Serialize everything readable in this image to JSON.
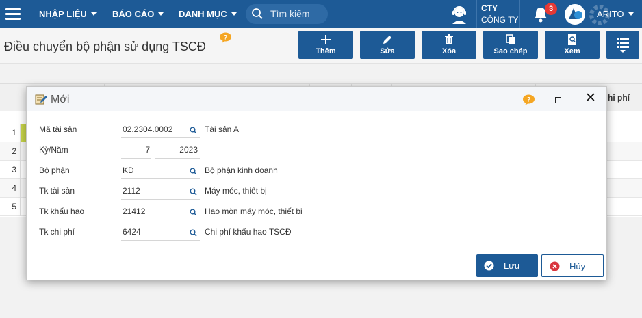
{
  "nav": {
    "menu": [
      {
        "label": "NHẬP LIỆU"
      },
      {
        "label": "BÁO CÁO"
      },
      {
        "label": "DANH MỤC"
      }
    ],
    "search_placeholder": "Tìm kiếm",
    "company_code": "CTY",
    "company_name": "CÔNG TY",
    "notification_count": "3",
    "user": "ARITO"
  },
  "page": {
    "title": "Điều chuyển bộ phận sử dụng TSCĐ"
  },
  "toolbar": {
    "add": "Thêm",
    "edit": "Sửa",
    "delete": "Xóa",
    "copy": "Sao chép",
    "view": "Xem"
  },
  "grid": {
    "last_column": "hi phí",
    "rows": [
      "1",
      "2",
      "3",
      "4",
      "5"
    ]
  },
  "dialog": {
    "title": "Mới",
    "fields": {
      "asset_code": {
        "label": "Mã tài sản",
        "value": "02.2304.0002",
        "desc": "Tài sản A"
      },
      "period": {
        "label": "Kỳ/Năm",
        "month": "7",
        "year": "2023"
      },
      "department": {
        "label": "Bộ phận",
        "value": "KD",
        "desc": "Bộ phận kinh doanh"
      },
      "asset_account": {
        "label": "Tk tài sản",
        "value": "2112",
        "desc": "Máy móc, thiết bị"
      },
      "depreciation_account": {
        "label": "Tk khấu hao",
        "value": "21412",
        "desc": "Hao mòn máy móc, thiết bị"
      },
      "expense_account": {
        "label": "Tk chi phí",
        "value": "6424",
        "desc": "Chi phí khấu hao TSCĐ"
      }
    },
    "save": "Lưu",
    "cancel": "Hủy"
  },
  "colors": {
    "primary": "#1d5a96",
    "badge": "#e53935",
    "help": "#f5a623"
  }
}
